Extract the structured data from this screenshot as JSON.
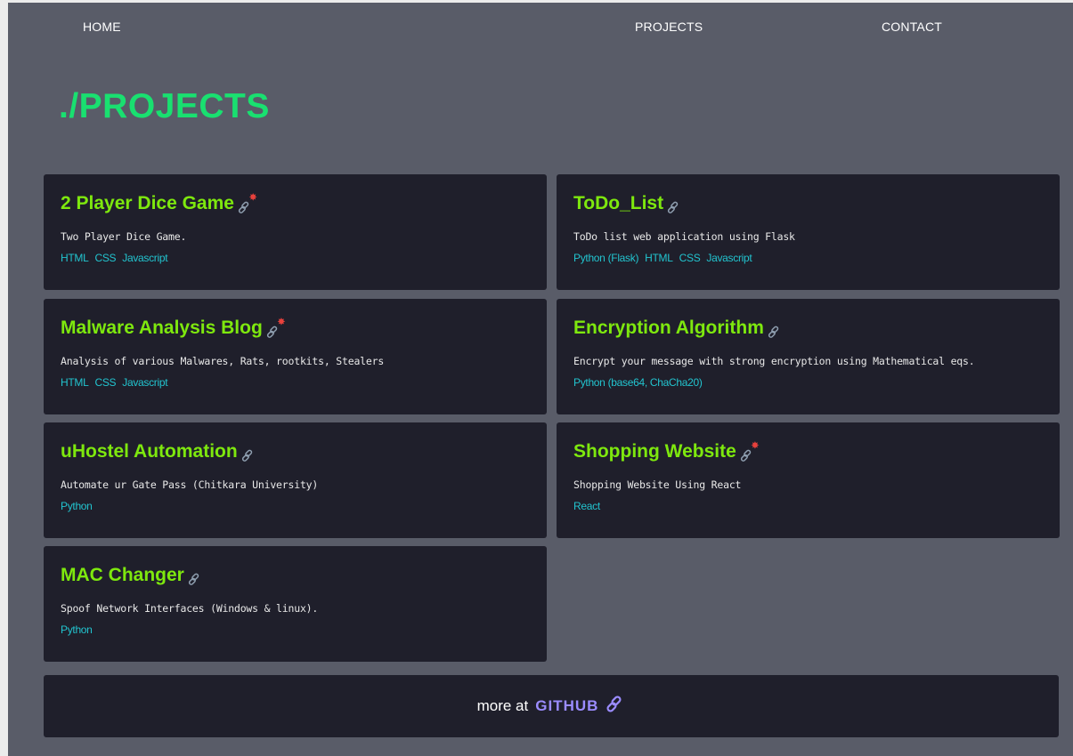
{
  "nav": {
    "home": "HOME",
    "projects": "PROJECTS",
    "contact": "CONTACT"
  },
  "page_title": "./PROJECTS",
  "projects": [
    {
      "title": "2 Player Dice Game",
      "starred": true,
      "description": "Two Player Dice Game.",
      "tags": [
        "HTML",
        "CSS",
        "Javascript"
      ]
    },
    {
      "title": "ToDo_List",
      "starred": false,
      "description": "ToDo list web application using Flask",
      "tags": [
        "Python (Flask)",
        "HTML",
        "CSS",
        "Javascript"
      ]
    },
    {
      "title": "Malware Analysis Blog",
      "starred": true,
      "description": "Analysis of various Malwares, Rats, rootkits, Stealers",
      "tags": [
        "HTML",
        "CSS",
        "Javascript"
      ]
    },
    {
      "title": "Encryption Algorithm",
      "starred": false,
      "description": "Encrypt your message with strong encryption using Mathematical eqs.",
      "tags": [
        "Python (base64, ChaCha20)"
      ]
    },
    {
      "title": "uHostel Automation",
      "starred": false,
      "description": "Automate ur Gate Pass (Chitkara University)",
      "tags": [
        "Python"
      ]
    },
    {
      "title": "Shopping Website",
      "starred": true,
      "description": "Shopping Website Using React",
      "tags": [
        "React"
      ]
    },
    {
      "title": "MAC Changer",
      "starred": false,
      "description": "Spoof Network Interfaces (Windows & linux).",
      "tags": [
        "Python"
      ]
    }
  ],
  "footer": {
    "more_text": "more at",
    "github_label": "GITHUB"
  },
  "colors": {
    "background": "#595c68",
    "card": "#1f1f2b",
    "title_green": "#7ee80e",
    "heading_green": "#19e070",
    "tag_cyan": "#22c4cf",
    "github_purple": "#9b8cff",
    "star_red": "#e8413c"
  },
  "icons": {
    "link": "link-icon",
    "star": "star-icon"
  }
}
